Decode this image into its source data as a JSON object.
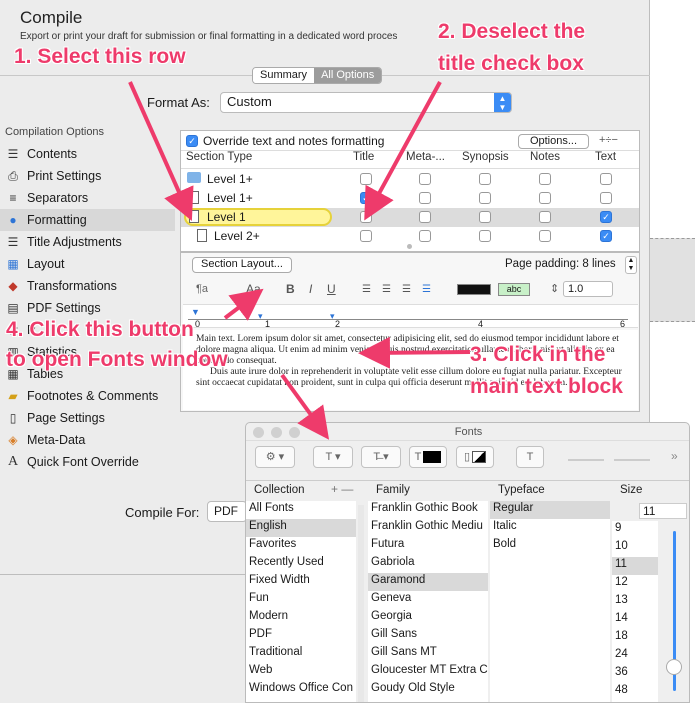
{
  "dialog": {
    "title": "Compile",
    "subtitle": "Export or print your draft for submission or final formatting in a dedicated word proces",
    "tabs": [
      "Summary",
      "All Options"
    ],
    "format_as_label": "Format As:",
    "format_as_value": "Custom",
    "compile_for_label": "Compile For:",
    "compile_for_value": "PDF"
  },
  "sidebar": {
    "header": "Compilation Options",
    "items": [
      {
        "label": "Contents",
        "icon": "list-icon"
      },
      {
        "label": "Print Settings",
        "icon": "printer-icon"
      },
      {
        "label": "Separators",
        "icon": "separator-icon"
      },
      {
        "label": "Formatting",
        "icon": "formatting-icon"
      },
      {
        "label": "Title Adjustments",
        "icon": "title-icon"
      },
      {
        "label": "Layout",
        "icon": "layout-icon"
      },
      {
        "label": "Transformations",
        "icon": "transform-icon"
      },
      {
        "label": "PDF Settings",
        "icon": "pdf-icon"
      },
      {
        "label": "R",
        "icon": "replace-icon"
      },
      {
        "label": "Statistics",
        "icon": "stats-icon"
      },
      {
        "label": "Tables",
        "icon": "table-icon"
      },
      {
        "label": "Footnotes & Comments",
        "icon": "footnote-icon"
      },
      {
        "label": "Page Settings",
        "icon": "page-icon"
      },
      {
        "label": "Meta-Data",
        "icon": "tag-icon"
      },
      {
        "label": "Quick Font Override",
        "icon": "font-icon"
      }
    ]
  },
  "formatting": {
    "override_label": "Override text and notes formatting",
    "options_button": "Options...",
    "plus_minus": "+÷−",
    "columns": [
      "Section Type",
      "Title",
      "Meta-...",
      "Synopsis",
      "Notes",
      "Text"
    ],
    "rows": [
      {
        "label": "Level  1+",
        "checks": [
          false,
          false,
          false,
          false,
          false
        ]
      },
      {
        "label": "Level  1+",
        "checks": [
          true,
          false,
          false,
          false,
          false
        ]
      },
      {
        "label": "Level  1",
        "checks": [
          false,
          false,
          false,
          false,
          true
        ]
      },
      {
        "label": "Level  2+",
        "checks": [
          false,
          false,
          false,
          false,
          true
        ]
      }
    ],
    "section_layout_button": "Section Layout...",
    "page_padding": "Page padding: 8 lines",
    "toolbar": {
      "para": "¶a",
      "aa": "Aa",
      "bold": "B",
      "italic": "I",
      "underline": "U",
      "highlight": "abc",
      "spacing": "1.0"
    },
    "ruler_numbers": [
      "0",
      "1",
      "2",
      "4",
      "6"
    ],
    "sample_text": "Main text. Lorem ipsum dolor sit amet, consectetur adipisicing elit, sed do eiusmod tempor incididunt labore et dolore magna aliqua. Ut enim ad minim veniam, quis nostrud exercitation ullamco laboris nisi ut aliquip ex ea commodo consequat.",
    "sample_text2": "Duis aute irure dolor in reprehenderit in voluptate velit esse cillum dolore eu fugiat nulla pariatur. Excepteur sint occaecat cupidatat non proident, sunt in culpa qui officia deserunt mollit anim id est laborum."
  },
  "fonts": {
    "title": "Fonts",
    "headers": [
      "Collection",
      "Family",
      "Typeface",
      "Size"
    ],
    "collections": [
      "All Fonts",
      "English",
      "Favorites",
      "Recently Used",
      "Fixed Width",
      "Fun",
      "Modern",
      "PDF",
      "Traditional",
      "Web",
      "Windows Office Con"
    ],
    "families": [
      "Franklin Gothic Book",
      "Franklin Gothic Mediu",
      "Futura",
      "Gabriola",
      "Garamond",
      "Geneva",
      "Georgia",
      "Gill Sans",
      "Gill Sans MT",
      "Gloucester MT Extra C",
      "Goudy Old Style"
    ],
    "typefaces": [
      "Regular",
      "Italic",
      "Bold"
    ],
    "size_value": "11",
    "sizes": [
      "9",
      "10",
      "11",
      "12",
      "13",
      "14",
      "18",
      "24",
      "36",
      "48"
    ],
    "add_remove": "+ —"
  },
  "annotations": {
    "a1": "1. Select this row",
    "a2_line1": "2. Deselect the",
    "a2_line2": "title check box",
    "a3_line1": "3. Click in the",
    "a3_line2": "main text block",
    "a4_line1": "4. Click this button",
    "a4_line2": "to open Fonts window",
    "color": "#ee3b6b"
  }
}
